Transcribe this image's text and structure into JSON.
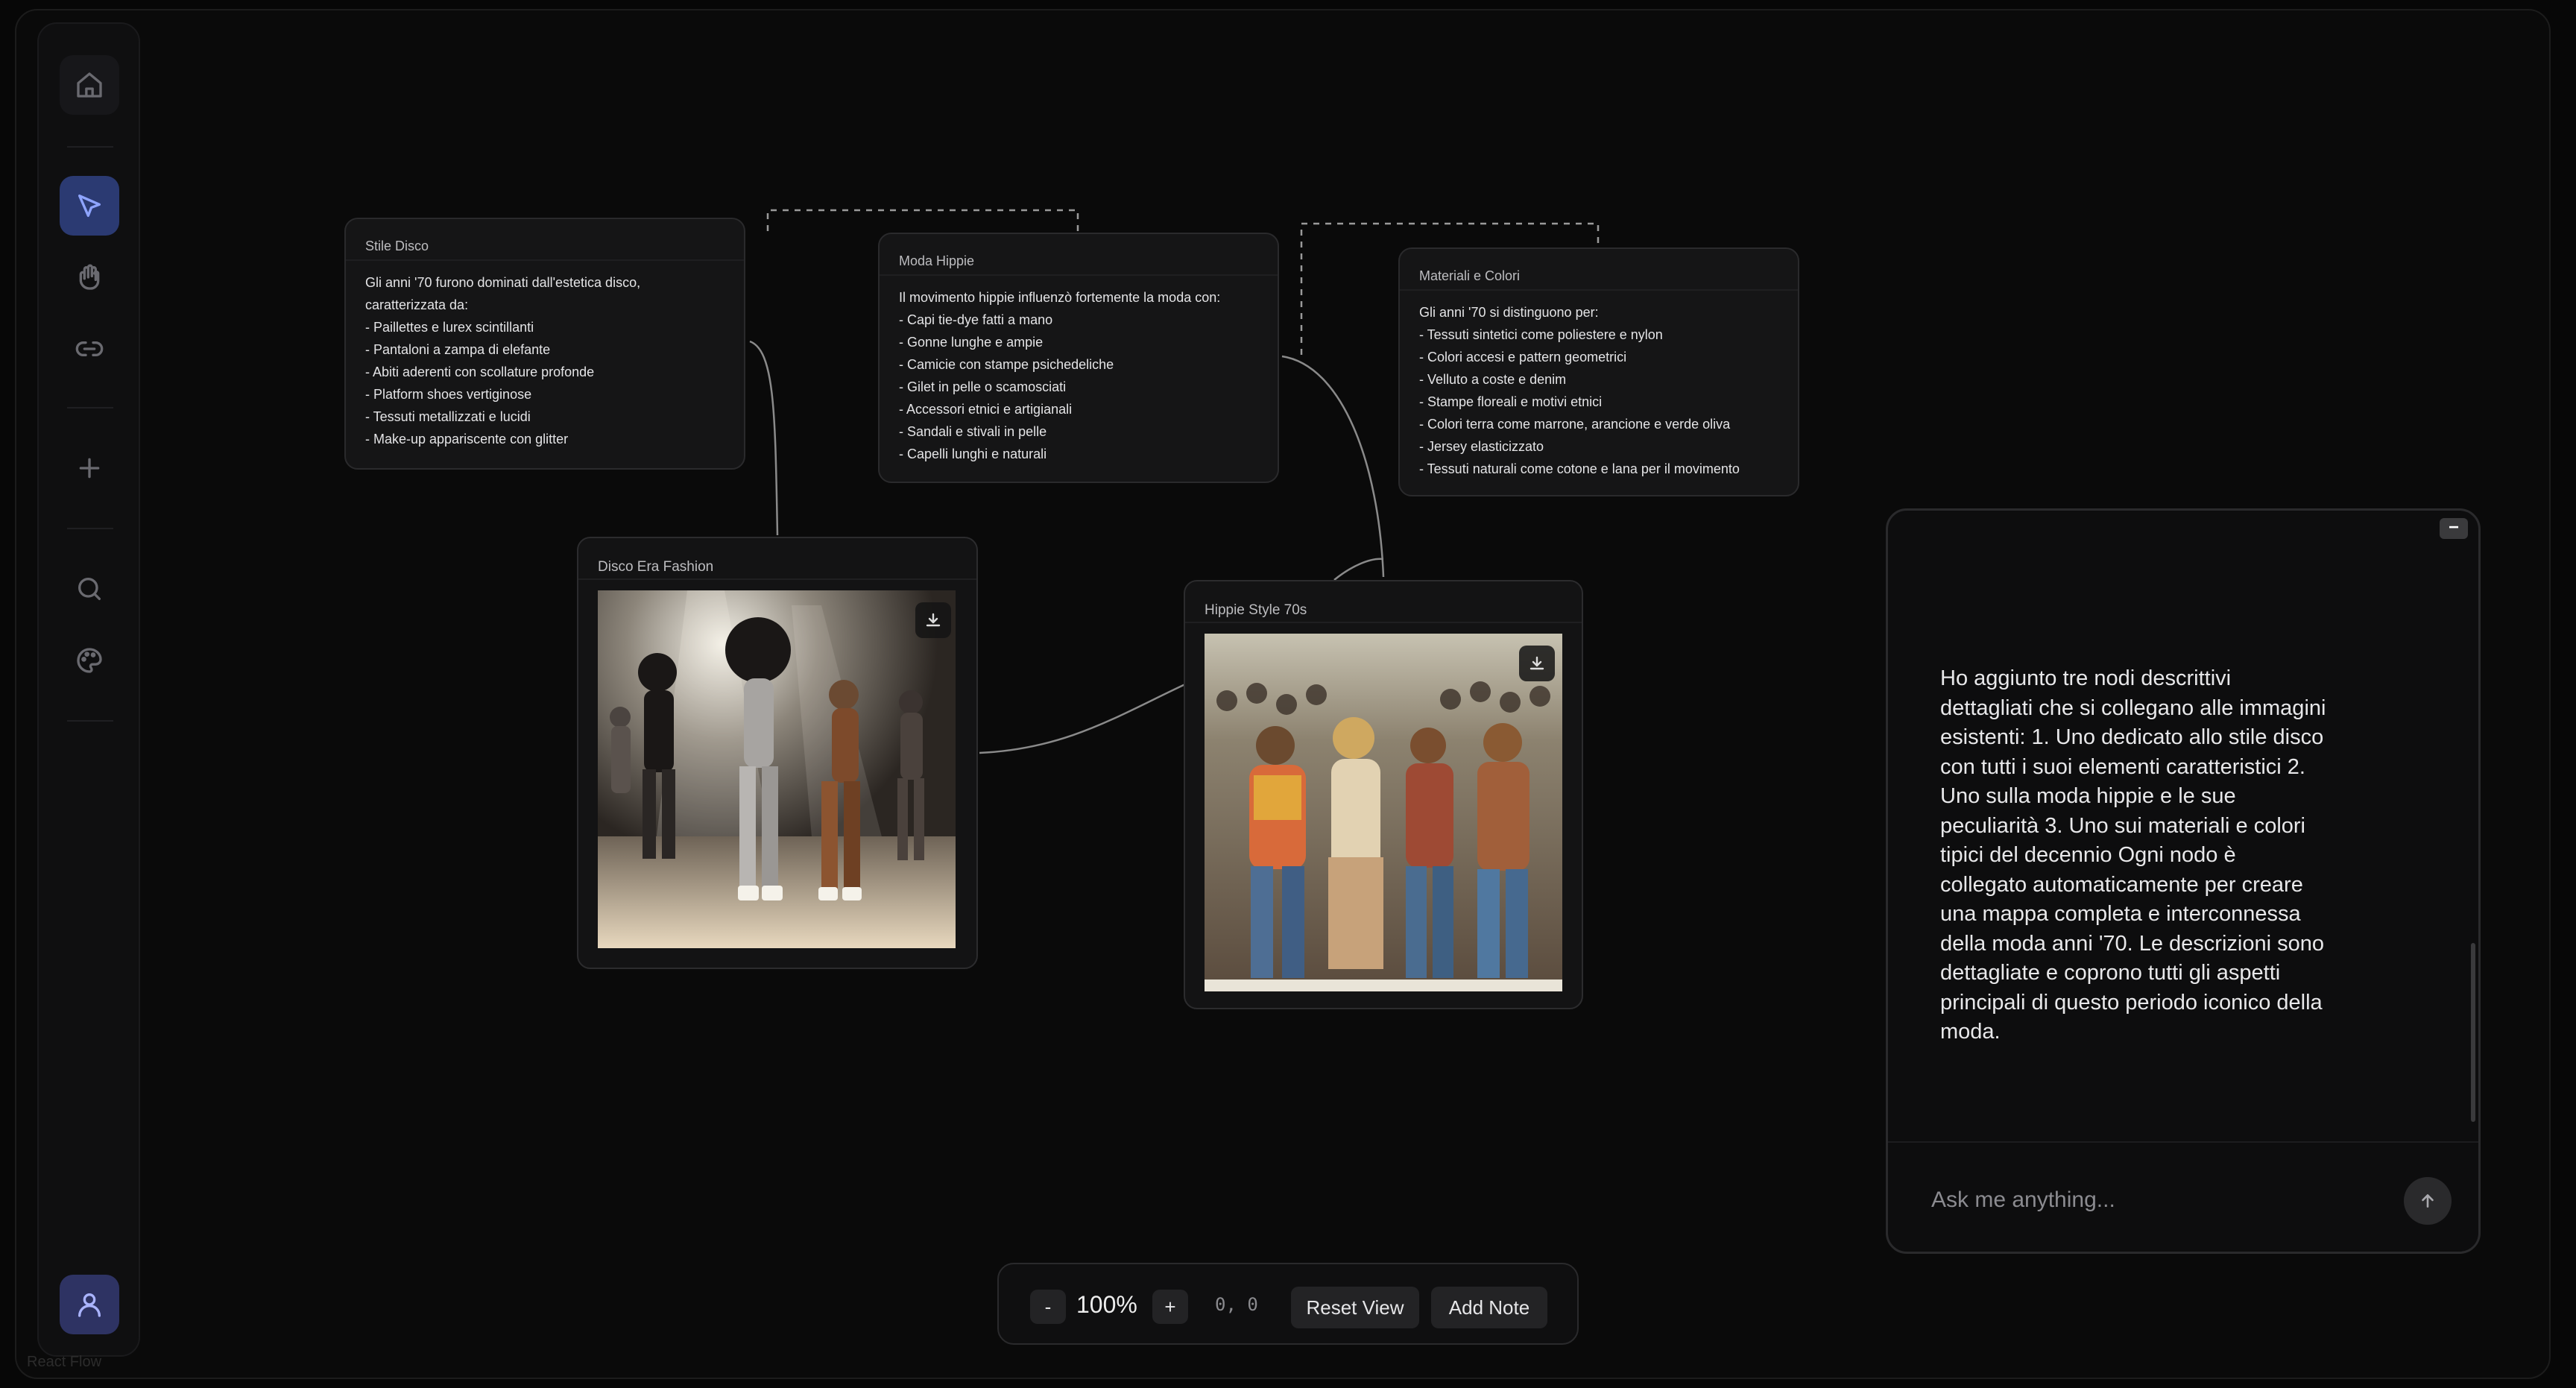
{
  "sidebar": {
    "icons": [
      "home-icon",
      "cursor-icon",
      "hand-icon",
      "link-icon",
      "plus-icon",
      "search-icon",
      "palette-icon",
      "user-icon"
    ]
  },
  "watermark": "React Flow",
  "notes": [
    {
      "title": "Stile Disco",
      "lines": [
        "Gli anni '70 furono dominati dall'estetica disco,",
        "caratterizzata da:",
        "- Paillettes e lurex scintillanti",
        "- Pantaloni a zampa di elefante",
        "- Abiti aderenti con scollature profonde",
        "- Platform shoes vertiginose",
        "- Tessuti metallizzati e lucidi",
        "- Make-up appariscente con glitter"
      ]
    },
    {
      "title": "Moda Hippie",
      "lines": [
        "Il movimento hippie influenzò fortemente la moda con:",
        "- Capi tie-dye fatti a mano",
        "- Gonne lunghe e ampie",
        "- Camicie con stampe psichedeliche",
        "- Gilet in pelle o scamosciati",
        "- Accessori etnici e artigianali",
        "- Sandali e stivali in pelle",
        "- Capelli lunghi e naturali"
      ]
    },
    {
      "title": "Materiali e Colori",
      "lines": [
        "Gli anni '70 si distinguono per:",
        "- Tessuti sintetici come poliestere e nylon",
        "- Colori accesi e pattern geometrici",
        "- Velluto a coste e denim",
        "- Stampe floreali e motivi etnici",
        "- Colori terra come marrone, arancione e verde oliva",
        "- Jersey elasticizzato",
        "- Tessuti naturali come cotone e lana per il movimento"
      ]
    }
  ],
  "images": [
    {
      "title": "Disco Era Fashion"
    },
    {
      "title": "Hippie Style 70s"
    }
  ],
  "chat": {
    "minimize_label": "−",
    "message": "Ho aggiunto tre nodi descrittivi dettagliati che si collegano alle immagini esistenti: 1. Uno dedicato allo stile disco con tutti i suoi elementi caratteristici 2. Uno sulla moda hippie e le sue peculiarità 3. Uno sui materiali e colori tipici del decennio Ogni nodo è collegato automaticamente per creare una mappa completa e interconnessa della moda anni '70. Le descrizioni sono dettagliate e coprono tutti gli aspetti principali di questo periodo iconico della moda.",
    "input_placeholder": "Ask me anything..."
  },
  "toolbar": {
    "zoom_out": "-",
    "zoom": "100%",
    "zoom_in": "+",
    "coords": "0, 0",
    "reset_view": "Reset View",
    "add_note": "Add Note"
  }
}
